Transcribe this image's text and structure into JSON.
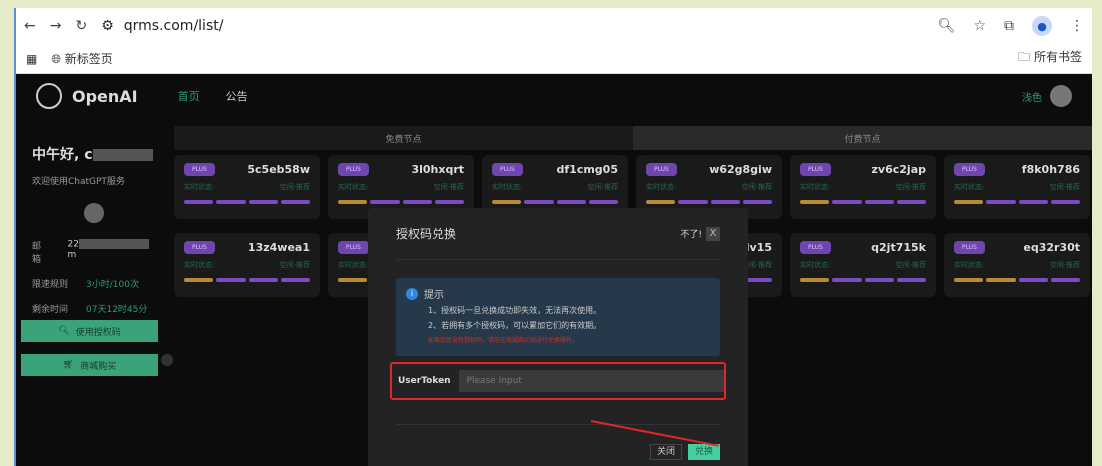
{
  "browser": {
    "url": "qrms.com/list/",
    "bookmark": "新标签页",
    "all_bookmarks": "所有书签"
  },
  "header": {
    "brand": "OpenAI",
    "nav": [
      "首页",
      "公告"
    ],
    "theme": "浅色"
  },
  "sidebar": {
    "greeting": "中午好, c",
    "welcome": "欢迎使用ChatGPT服务",
    "email_label": "邮箱",
    "email_prefix": "22",
    "email_suffix": "m",
    "rate_label": "限速规则",
    "rate_value": "3小时/100次",
    "remain_label": "剩余时间",
    "remain_value": "07天12时45分",
    "btn_code": "使用授权码",
    "btn_shop": "商城购买"
  },
  "tabs": [
    "免费节点",
    "付费节点"
  ],
  "cards": [
    {
      "tag": "PLUS",
      "id": "5c5eb58w",
      "status": "实时状态:",
      "load": "空闲·推荐",
      "bars": [
        "p",
        "p",
        "p",
        "p"
      ]
    },
    {
      "tag": "PLUS",
      "id": "3l0hxqrt",
      "status": "实时状态:",
      "load": "空闲·推荐",
      "bars": [
        "o",
        "p",
        "p",
        "p"
      ]
    },
    {
      "tag": "PLUS",
      "id": "df1cmg05",
      "status": "实时状态:",
      "load": "空闲·推荐",
      "bars": [
        "o",
        "p",
        "p",
        "p"
      ]
    },
    {
      "tag": "PLUS",
      "id": "w62g8giw",
      "status": "实时状态:",
      "load": "空闲·推荐",
      "bars": [
        "o",
        "p",
        "p",
        "p"
      ]
    },
    {
      "tag": "PLUS",
      "id": "zv6c2jap",
      "status": "实时状态:",
      "load": "空闲·推荐",
      "bars": [
        "o",
        "p",
        "p",
        "p"
      ]
    },
    {
      "tag": "PLUS",
      "id": "f8k0h786",
      "status": "实时状态:",
      "load": "空闲·推荐",
      "bars": [
        "o",
        "p",
        "p",
        "p"
      ]
    },
    {
      "tag": "PLUS",
      "id": "13z4wea1",
      "status": "实时状态:",
      "load": "空闲·推荐",
      "bars": [
        "o",
        "p",
        "p",
        "p"
      ]
    },
    {
      "tag": "PLUS",
      "id": "",
      "status": "实时状态:",
      "load": "",
      "bars": [
        "o",
        "p",
        "p",
        "p"
      ]
    },
    {
      "tag": "PLUS",
      "id": "",
      "status": "",
      "load": "",
      "bars": [
        "o",
        "p",
        "p",
        "p"
      ]
    },
    {
      "tag": "PLUS",
      "id": "dv15",
      "status": "实时状态:",
      "load": "空闲·推荐",
      "bars": [
        "o",
        "p",
        "p",
        "p"
      ]
    },
    {
      "tag": "PLUS",
      "id": "q2jt715k",
      "status": "实时状态:",
      "load": "空闲·推荐",
      "bars": [
        "o",
        "p",
        "p",
        "p"
      ]
    },
    {
      "tag": "PLUS",
      "id": "eq32r30t",
      "status": "实时状态:",
      "load": "空闲·推荐",
      "bars": [
        "o",
        "o",
        "p",
        "p"
      ]
    }
  ],
  "modal": {
    "title": "授权码兑换",
    "dismiss": "不了!",
    "close_x": "X",
    "tip_title": "提示",
    "tip1": "1、授权码一旦兑换成功即失效，无法再次使用。",
    "tip2": "2、若拥有多个授权码，可以累加它们的有效期。",
    "tip_red": "如果您还没有授权码，请前往商城购买后进行兑换操作。",
    "field_label": "UserToken",
    "field_placeholder": "Please Input",
    "btn_close": "关闭",
    "btn_redeem": "兑换"
  }
}
